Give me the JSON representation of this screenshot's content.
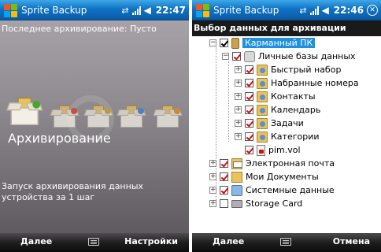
{
  "left_screen": {
    "title": "Sprite Backup",
    "clock": "22:47",
    "last_backup": "Последнее архивирование: Пусто",
    "action_label": "Архивирование",
    "description": "Запуск архивирования данных устройства за 1 шаг",
    "softkeys": {
      "left": "Далее",
      "right": "Настройки"
    },
    "action_icons": [
      "backup-box-icon",
      "backup-box-icon",
      "backup-box-icon",
      "backup-box-icon",
      "backup-box-icon"
    ]
  },
  "right_screen": {
    "title": "Sprite Backup",
    "clock": "22:46",
    "header": "Выбор данных для архивации",
    "tree": {
      "root": "Карманный ПК",
      "personal_db": "Личные базы данных",
      "items": [
        "Быстрый набор",
        "Набранные номера",
        "Контакты",
        "Календарь",
        "Задачи",
        "Категории",
        "pim.vol"
      ],
      "email": "Электронная почта",
      "documents": "Мои Документы",
      "system": "Системные данные",
      "storage": "Storage Card"
    },
    "softkeys": {
      "left": "Далее",
      "right": "Отмена"
    }
  },
  "colors": {
    "title_bar": "#0f73c6",
    "selection": "#1f8fe0",
    "softkey_bar": "#1e1e1e",
    "check_red": "#d01010"
  }
}
